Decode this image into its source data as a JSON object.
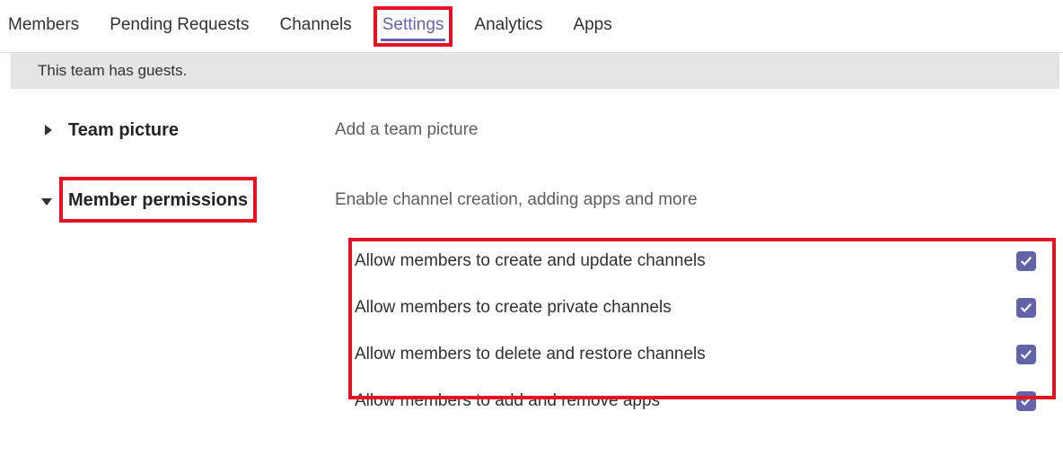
{
  "tabs": {
    "members": "Members",
    "pending_requests": "Pending Requests",
    "channels": "Channels",
    "settings": "Settings",
    "analytics": "Analytics",
    "apps": "Apps"
  },
  "info_bar": "This team has guests.",
  "sections": {
    "team_picture": {
      "title": "Team picture",
      "desc": "Add a team picture"
    },
    "member_permissions": {
      "title": "Member permissions",
      "desc": "Enable channel creation, adding apps and more",
      "items": [
        {
          "label": "Allow members to create and update channels",
          "checked": true
        },
        {
          "label": "Allow members to create private channels",
          "checked": true
        },
        {
          "label": "Allow members to delete and restore channels",
          "checked": true
        },
        {
          "label": "Allow members to add and remove apps",
          "checked": true
        }
      ]
    }
  }
}
